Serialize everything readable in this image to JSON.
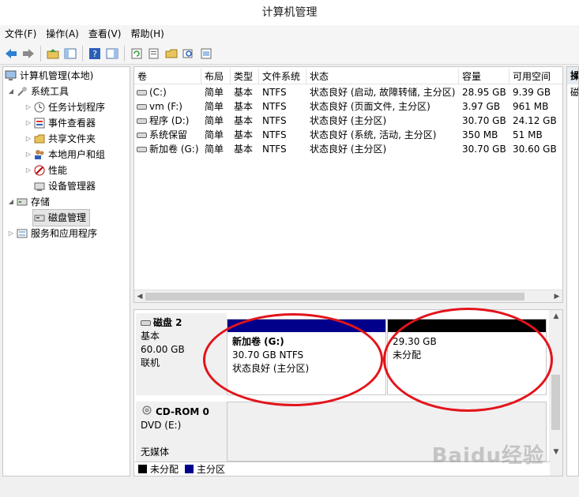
{
  "window": {
    "title": "计算机管理"
  },
  "menu": [
    "文件(F)",
    "操作(A)",
    "查看(V)",
    "帮助(H)"
  ],
  "toolbar": {
    "icons": [
      "back-icon",
      "forward-icon",
      "up-icon",
      "show-hide-tree-icon",
      "help-icon",
      "action-pane-icon",
      "refresh-icon",
      "properties-icon",
      "open-icon",
      "search-icon",
      "export-icon"
    ]
  },
  "tree": {
    "root": "计算机管理(本地)",
    "system_tools": "系统工具",
    "task_scheduler": "任务计划程序",
    "event_viewer": "事件查看器",
    "shared_folders": "共享文件夹",
    "local_users": "本地用户和组",
    "performance": "性能",
    "device_manager": "设备管理器",
    "storage": "存储",
    "disk_management": "磁盘管理",
    "services_apps": "服务和应用程序"
  },
  "volumes": {
    "headers": [
      "卷",
      "布局",
      "类型",
      "文件系统",
      "状态",
      "容量",
      "可用空间"
    ],
    "rows": [
      [
        "(C:)",
        "简单",
        "基本",
        "NTFS",
        "状态良好 (启动, 故障转储, 主分区)",
        "28.95 GB",
        "9.39 GB"
      ],
      [
        "vm (F:)",
        "简单",
        "基本",
        "NTFS",
        "状态良好 (页面文件, 主分区)",
        "3.97 GB",
        "961 MB"
      ],
      [
        "程序 (D:)",
        "简单",
        "基本",
        "NTFS",
        "状态良好 (主分区)",
        "30.70 GB",
        "24.12 GB"
      ],
      [
        "系统保留",
        "简单",
        "基本",
        "NTFS",
        "状态良好 (系统, 活动, 主分区)",
        "350 MB",
        "51 MB"
      ],
      [
        "新加卷 (G:)",
        "简单",
        "基本",
        "NTFS",
        "状态良好 (主分区)",
        "30.70 GB",
        "30.60 GB"
      ]
    ]
  },
  "disk2": {
    "name": "磁盘 2",
    "type": "基本",
    "size": "60.00 GB",
    "status": "联机",
    "partitions": [
      {
        "title": "新加卷  (G:)",
        "size": "30.70 GB NTFS",
        "status": "状态良好 (主分区)",
        "color": "#00008b"
      },
      {
        "title": "",
        "size": "29.30 GB",
        "status": "未分配",
        "color": "#000000"
      }
    ]
  },
  "cdrom": {
    "name": "CD-ROM 0",
    "type": "DVD (E:)",
    "media": "无媒体"
  },
  "legend": [
    {
      "label": "未分配",
      "color": "#000000"
    },
    {
      "label": "主分区",
      "color": "#00008b"
    }
  ],
  "action_pane": {
    "header": "操",
    "item": "磁"
  },
  "watermark": "Baidu经验",
  "colors": {
    "annotation": "#e3141b",
    "primary_partition": "#00008b",
    "unallocated": "#000000"
  }
}
